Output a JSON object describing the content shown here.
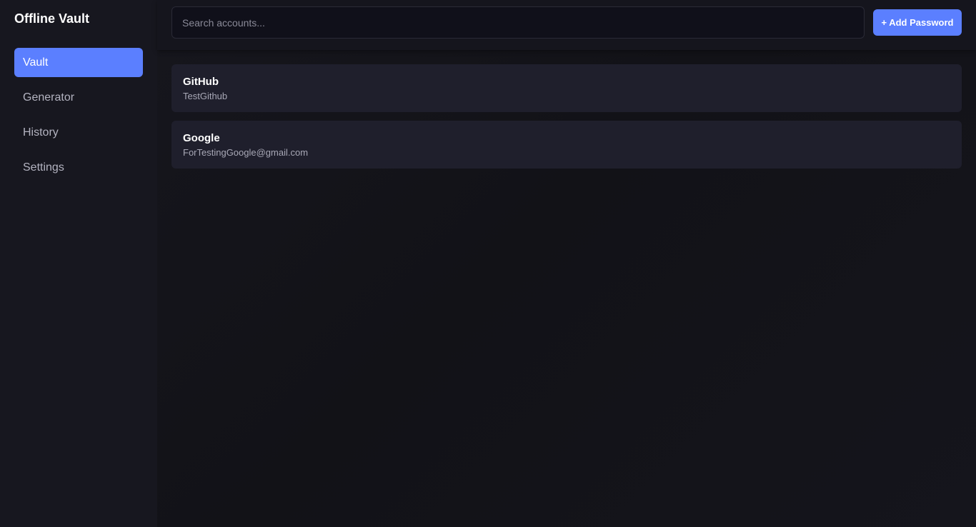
{
  "app": {
    "title": "Offline Vault"
  },
  "sidebar": {
    "items": [
      {
        "label": "Vault",
        "active": true
      },
      {
        "label": "Generator",
        "active": false
      },
      {
        "label": "History",
        "active": false
      },
      {
        "label": "Settings",
        "active": false
      }
    ]
  },
  "toolbar": {
    "search_placeholder": "Search accounts...",
    "search_value": "",
    "add_label": "+ Add Password"
  },
  "accounts": [
    {
      "name": "GitHub",
      "username": "TestGithub"
    },
    {
      "name": "Google",
      "username": "ForTestingGoogle@gmail.com"
    }
  ],
  "colors": {
    "accent": "#5b7fff",
    "sidebar_bg": "#17171f",
    "card_bg": "#1f1f2c"
  }
}
